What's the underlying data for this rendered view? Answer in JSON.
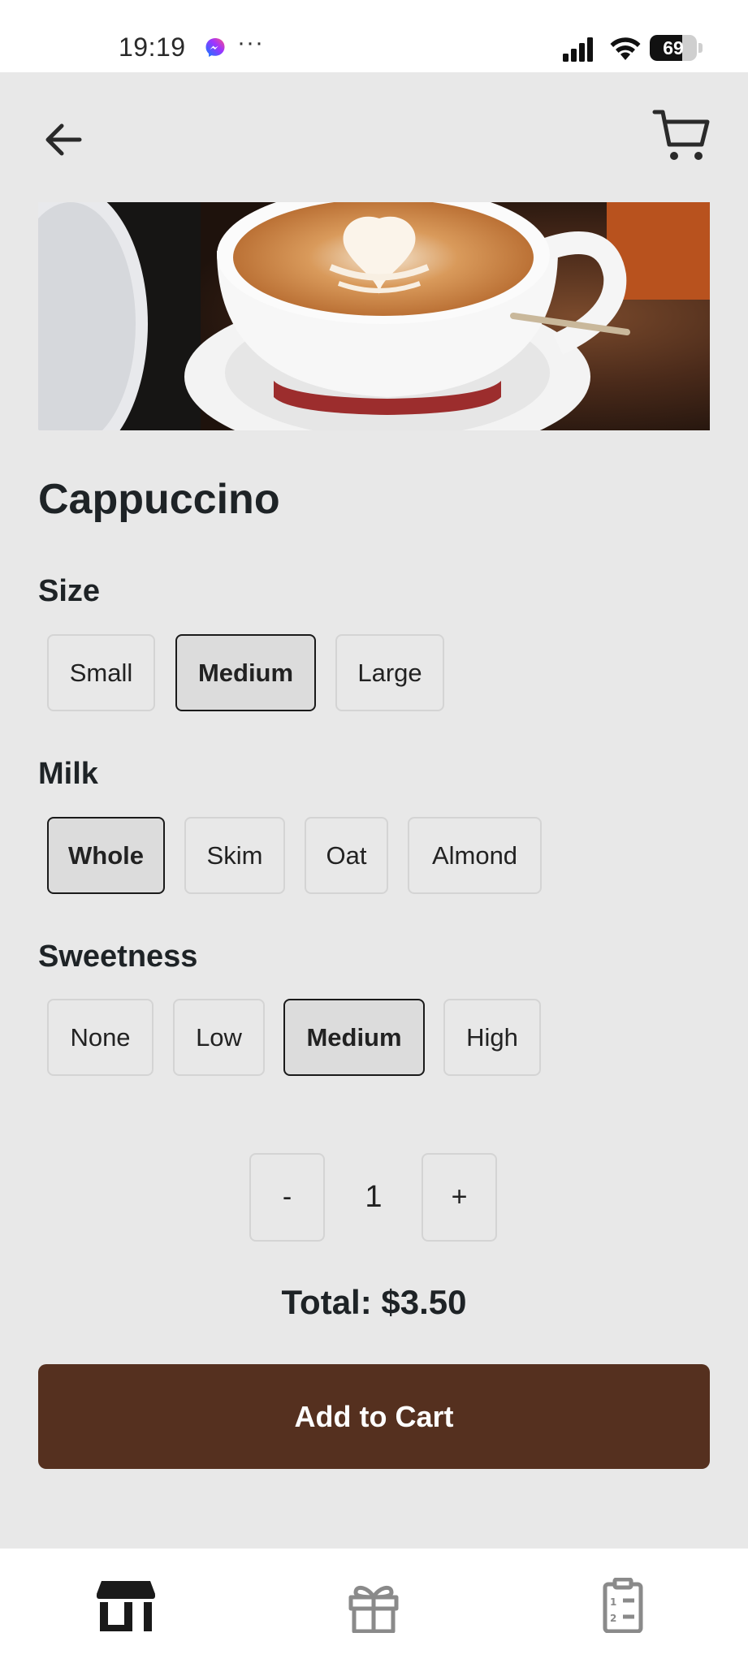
{
  "status_bar": {
    "time": "19:19",
    "dots": "···",
    "battery": "69",
    "battery_level": 0.69
  },
  "header": {
    "back_icon": "arrow-left-icon",
    "cart_icon": "shopping-cart-icon"
  },
  "product": {
    "title": "Cappuccino",
    "image": "cappuccino-latte-art-photo"
  },
  "size": {
    "label": "Size",
    "options": [
      "Small",
      "Medium",
      "Large"
    ],
    "selected": "Medium"
  },
  "milk": {
    "label": "Milk",
    "options": [
      "Whole",
      "Skim",
      "Oat",
      "Almond"
    ],
    "selected": "Whole"
  },
  "sweetness": {
    "label": "Sweetness",
    "options": [
      "None",
      "Low",
      "Medium",
      "High"
    ],
    "selected": "Medium"
  },
  "quantity": {
    "decrement": "-",
    "value": "1",
    "increment": "+"
  },
  "total": "Total: $3.50",
  "add_to_cart": "Add to Cart",
  "bottom_nav": {
    "items": [
      "store-icon",
      "gift-icon",
      "order-list-icon"
    ],
    "active": "store-icon"
  },
  "colors": {
    "background": "#e8e8e8",
    "primary_button": "#55301f",
    "selected_border": "#1a1a1a"
  }
}
